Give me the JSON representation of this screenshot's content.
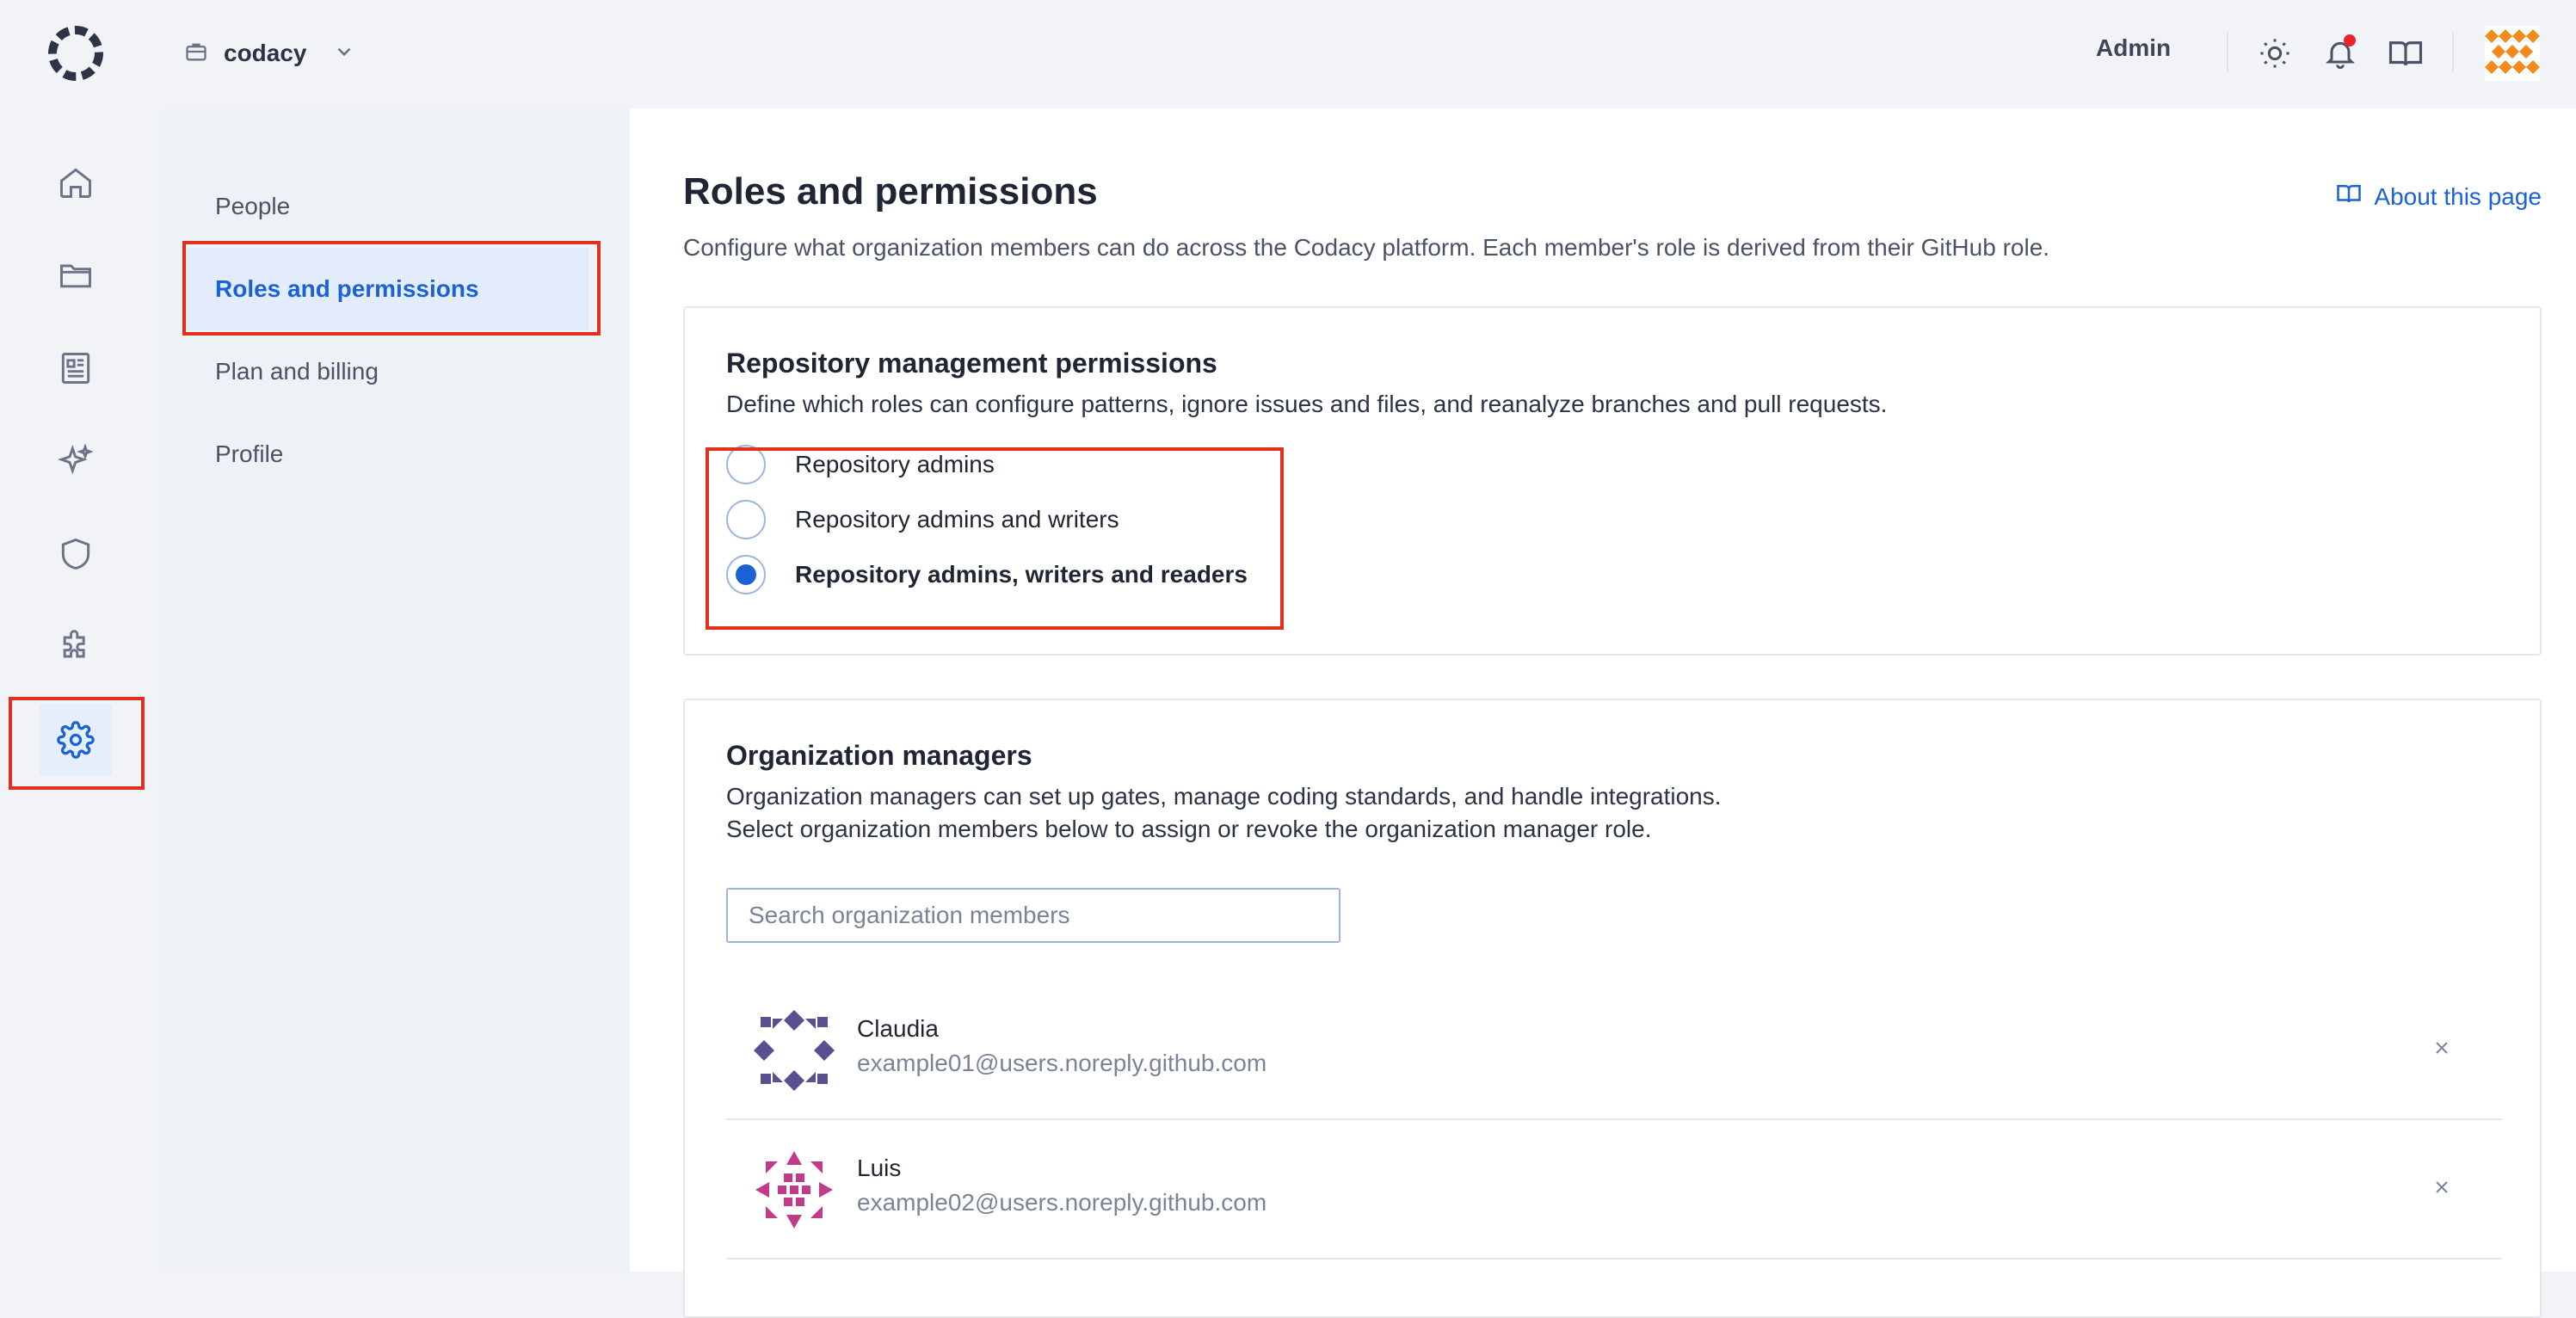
{
  "topbar": {
    "org_name": "codacy",
    "role_label": "Admin",
    "icons": [
      "codacy-logo-icon",
      "briefcase-icon",
      "chevron-down-icon",
      "sun-icon",
      "bell-icon",
      "book-icon",
      "user-avatar"
    ]
  },
  "rail": {
    "items": [
      "home-icon",
      "folder-icon",
      "newspaper-icon",
      "sparkles-icon",
      "shield-icon",
      "puzzle-icon",
      "gear-icon"
    ],
    "active": "gear-icon"
  },
  "submenu": {
    "items": [
      {
        "label": "People"
      },
      {
        "label": "Roles and permissions",
        "active": true
      },
      {
        "label": "Plan and billing"
      },
      {
        "label": "Profile"
      }
    ]
  },
  "page": {
    "title": "Roles and permissions",
    "about_link": "About this page",
    "description": "Configure what organization members can do across the Codacy platform. Each member's role is derived from their GitHub role."
  },
  "repo_permissions": {
    "title": "Repository management permissions",
    "description": "Define which roles can configure patterns, ignore issues and files, and reanalyze branches and pull requests.",
    "options": [
      {
        "label": "Repository admins",
        "checked": false
      },
      {
        "label": "Repository admins and writers",
        "checked": false
      },
      {
        "label": "Repository admins, writers and readers",
        "checked": true
      }
    ]
  },
  "org_managers": {
    "title": "Organization managers",
    "description_line1": "Organization managers can set up gates, manage coding standards, and handle integrations.",
    "description_line2": "Select organization members below to assign or revoke the organization manager role.",
    "search_placeholder": "Search organization members",
    "members": [
      {
        "name": "Claudia",
        "email": "example01@users.noreply.github.com",
        "avatar_color": "#5a4f8f"
      },
      {
        "name": "Luis",
        "email": "example02@users.noreply.github.com",
        "avatar_color": "#c23a8a"
      }
    ]
  },
  "colors": {
    "accent": "#1b63d4",
    "highlight": "#e1301e",
    "top_avatar": "#f28a1c"
  }
}
